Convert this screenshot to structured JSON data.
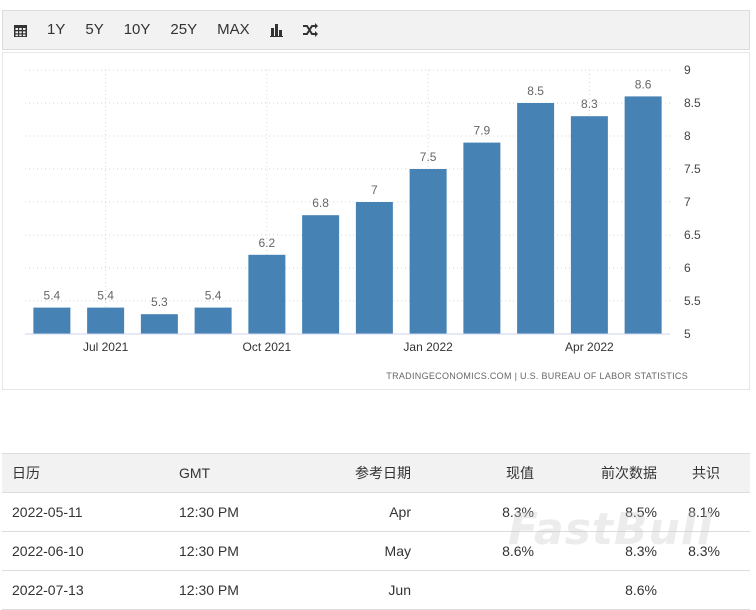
{
  "toolbar": {
    "calendar_icon": "calendar-icon",
    "ranges": [
      "1Y",
      "5Y",
      "10Y",
      "25Y",
      "MAX"
    ],
    "bar_icon": "bar-chart-icon",
    "compare_icon": "shuffle-icon"
  },
  "chart_data": {
    "type": "bar",
    "values": [
      5.4,
      5.4,
      5.3,
      5.4,
      6.2,
      6.8,
      7,
      7.5,
      7.9,
      8.5,
      8.3,
      8.6
    ],
    "x_ticks": [
      "Jul 2021",
      "Oct 2021",
      "Jan 2022",
      "Apr 2022"
    ],
    "y_ticks": [
      "5",
      "5.5",
      "6",
      "6.5",
      "7",
      "7.5",
      "8",
      "8.5",
      "9"
    ],
    "ylim": [
      5,
      9
    ],
    "bar_color": "#4682b4",
    "grid": true,
    "axis_side": "right",
    "source": "TRADINGECONOMICS.COM  |  U.S. BUREAU OF LABOR STATISTICS"
  },
  "table": {
    "headers": [
      "日历",
      "GMT",
      "参考日期",
      "现值",
      "前次数据",
      "共识"
    ],
    "rows": [
      [
        "2022-05-11",
        "12:30 PM",
        "Apr",
        "8.3%",
        "8.5%",
        "8.1%"
      ],
      [
        "2022-06-10",
        "12:30 PM",
        "May",
        "8.6%",
        "8.3%",
        "8.3%"
      ],
      [
        "2022-07-13",
        "12:30 PM",
        "Jun",
        "",
        "8.6%",
        ""
      ]
    ]
  },
  "watermark": "FastBull"
}
